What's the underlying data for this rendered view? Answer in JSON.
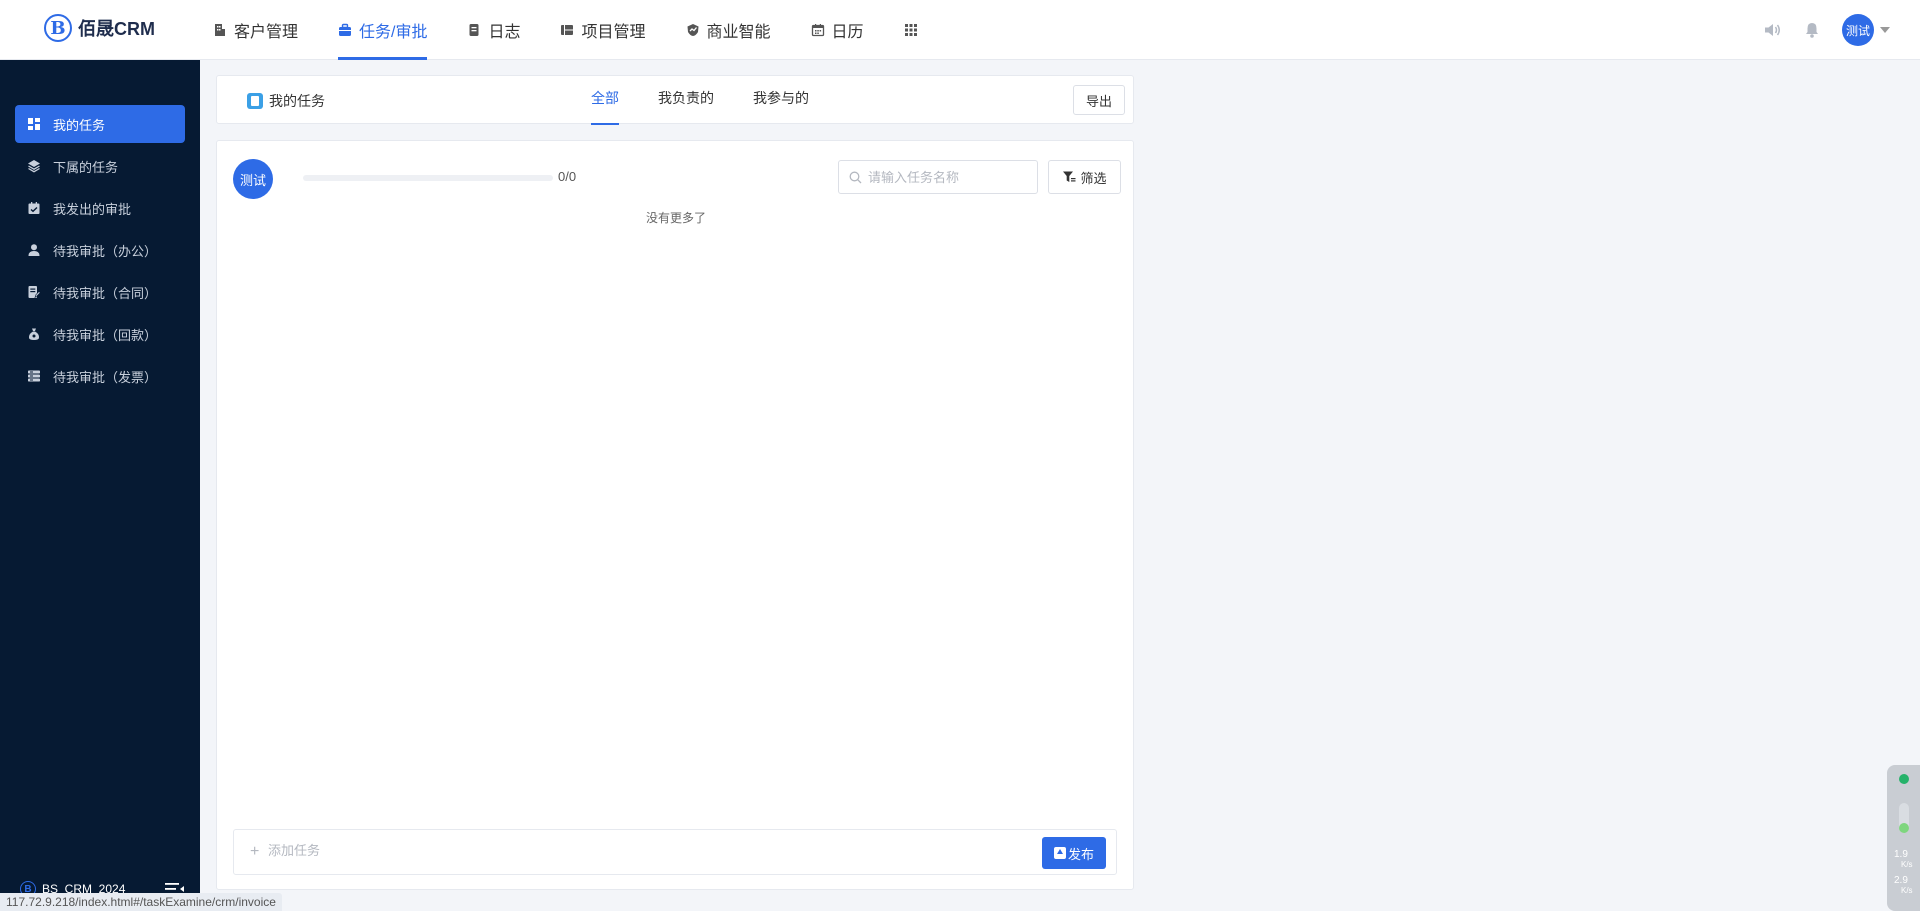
{
  "app": {
    "logo_text": "佰晟CRM",
    "logo_letter": "B"
  },
  "nav": {
    "items": [
      {
        "label": "客户管理",
        "icon": "building-icon"
      },
      {
        "label": "任务/审批",
        "icon": "briefcase-icon",
        "active": true
      },
      {
        "label": "日志",
        "icon": "notebook-icon"
      },
      {
        "label": "项目管理",
        "icon": "project-board-icon"
      },
      {
        "label": "商业智能",
        "icon": "shield-chart-icon"
      },
      {
        "label": "日历",
        "icon": "calendar-icon"
      },
      {
        "label": "",
        "icon": "apps-grid-icon"
      }
    ]
  },
  "user": {
    "name": "测试"
  },
  "sidebar": {
    "items": [
      {
        "label": "我的任务",
        "icon": "dashboard-icon",
        "active": true
      },
      {
        "label": "下属的任务",
        "icon": "layers-icon"
      },
      {
        "label": "我发出的审批",
        "icon": "calendar-check-icon"
      },
      {
        "label": "待我审批（办公）",
        "icon": "person-icon"
      },
      {
        "label": "待我审批（合同）",
        "icon": "contract-edit-icon"
      },
      {
        "label": "待我审批（回款）",
        "icon": "money-bag-icon"
      },
      {
        "label": "待我审批（发票）",
        "icon": "invoice-stack-icon"
      }
    ],
    "footer_label": "BS_CRM_2024"
  },
  "status_url": "117.72.9.218/index.html#/taskExamine/crm/invoice",
  "header": {
    "title": "我的任务",
    "tabs": [
      {
        "label": "全部",
        "active": true
      },
      {
        "label": "我负责的"
      },
      {
        "label": "我参与的"
      }
    ],
    "export_label": "导出"
  },
  "tasks": {
    "progress_text": "0/0",
    "progress_fraction": 0,
    "search_placeholder": "请输入任务名称",
    "filter_label": "筛选",
    "empty_text": "没有更多了",
    "add_placeholder": "添加任务",
    "add_plus": "+",
    "publish_label": "发布"
  },
  "speed_widget": {
    "up_value": "1.9",
    "up_unit": "K/s",
    "down_value": "2.9",
    "down_unit": "K/s"
  },
  "colors": {
    "accent": "#2e6be6",
    "sidebar_bg": "#061a33",
    "page_bg": "#f3f5f9"
  }
}
